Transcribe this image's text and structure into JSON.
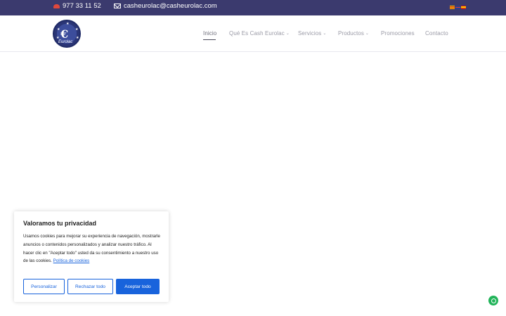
{
  "topbar": {
    "phone": "977 33 11 52",
    "email": "casheurolac@casheurolac.com",
    "flags": [
      "ca",
      "en",
      "es"
    ],
    "background": "#3b3a6e"
  },
  "logo": {
    "text": "Eurolac",
    "symbol": "€"
  },
  "nav": {
    "items": [
      {
        "label": "Inicio",
        "active": true,
        "dropdown": false
      },
      {
        "label": "Qué Es Cash Eurolac",
        "active": false,
        "dropdown": true
      },
      {
        "label": "Servicios",
        "active": false,
        "dropdown": true
      },
      {
        "label": "Productos",
        "active": false,
        "dropdown": true
      },
      {
        "label": "Promociones",
        "active": false,
        "dropdown": false
      },
      {
        "label": "Contacto",
        "active": false,
        "dropdown": false
      }
    ]
  },
  "cookie": {
    "title": "Valoramos tu privacidad",
    "text": "Usamos cookies para mejorar su experiencia de navegación, mostrarle anuncios o contenidos personalizados y analizar nuestro tráfico. Al hacer clic en \"Aceptar todo\" usted da su consentimiento a nuestro uso de las cookies.",
    "link": "Política de cookies",
    "buttons": {
      "customize": "Personalizar",
      "reject": "Rechazar todo",
      "accept": "Aceptar todo"
    },
    "accent": "#1863dc"
  },
  "whatsapp": {
    "icon": "whatsapp-icon",
    "color": "#22b45a"
  }
}
